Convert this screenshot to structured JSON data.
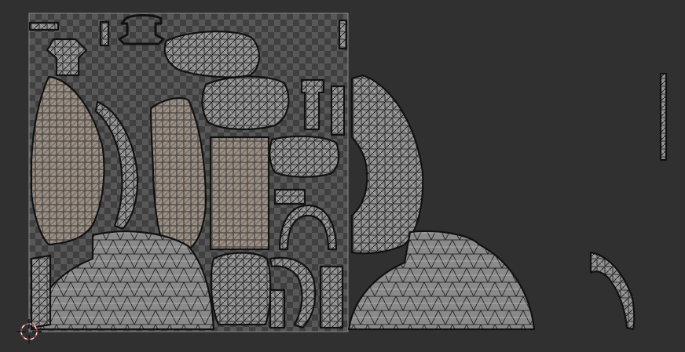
{
  "editor": {
    "name": "UV Editor",
    "background_color": "#303030",
    "texture_bounds_color": "#8a8a8a",
    "checker_light": "#5a5a5a",
    "checker_dark": "#404040",
    "island_fill": "#8a8a8a",
    "island_fill_selected": "#9a9086",
    "edge_color": "#111111",
    "wire_color": "#d8d8d8",
    "cursor_color": "#e6e6e6",
    "cursor_accent": "#d03c3c"
  },
  "icons": {
    "cursor": "2d-cursor-icon"
  }
}
